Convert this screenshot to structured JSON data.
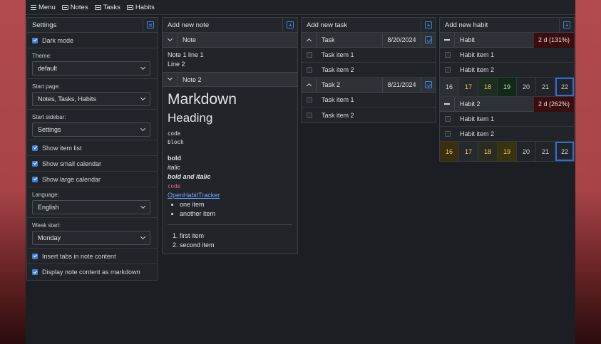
{
  "topbar": {
    "menu": "Menu",
    "notes": "Notes",
    "tasks": "Tasks",
    "habits": "Habits"
  },
  "settings": {
    "title": "Settings",
    "dark_mode": "Dark mode",
    "theme_label": "Theme:",
    "theme_value": "default",
    "start_page_label": "Start page:",
    "start_page_value": "Notes, Tasks, Habits",
    "start_sidebar_label": "Start sidebar:",
    "start_sidebar_value": "Settings",
    "show_item_list": "Show item list",
    "show_small_calendar": "Show small calendar",
    "show_large_calendar": "Show large calendar",
    "language_label": "Language:",
    "language_value": "English",
    "week_start_label": "Week start:",
    "week_start_value": "Monday",
    "insert_tabs": "Insert tabs in note content",
    "display_markdown": "Display note content as markdown"
  },
  "notes": {
    "title": "Add new note",
    "note1": {
      "name": "Note",
      "line1": "Note 1 line 1",
      "line2": "Line 2"
    },
    "note2": {
      "name": "Note 2",
      "h1": "Markdown",
      "h2": "Heading",
      "code1": "code",
      "code2": "block",
      "bold": "bold",
      "italic": "italic",
      "bold_italic": "bold and italic",
      "inline_code": "code",
      "link": "OpenHabitTracker",
      "ul1": "one item",
      "ul2": "another item",
      "ol1": "first item",
      "ol2": "second item"
    }
  },
  "tasks": {
    "title": "Add new task",
    "task1": {
      "name": "Task",
      "date": "8/20/2024",
      "item1": "Task item 1",
      "item2": "Task item 2"
    },
    "task2": {
      "name": "Task 2",
      "date": "8/21/2024",
      "item1": "Task item 1",
      "item2": "Task item 2"
    }
  },
  "habits": {
    "title": "Add new habit",
    "habit1": {
      "name": "Habit",
      "badge": "2 d (131%)",
      "item1": "Habit item 1",
      "item2": "Habit item 2",
      "days": [
        "16",
        "17",
        "18",
        "19",
        "20",
        "21",
        "22"
      ]
    },
    "habit2": {
      "name": "Habit 2",
      "badge": "2 d (262%)",
      "item1": "Habit item 1",
      "item2": "Habit item 2",
      "days": [
        "16",
        "17",
        "18",
        "19",
        "20",
        "21",
        "22"
      ]
    }
  },
  "colors": {
    "accent": "#3f7fd6",
    "badge_bg": "#3a0d10",
    "habit1_day_colors": [
      "#2c3034",
      "#262a2e",
      "#1e2d22",
      "#0f2a17",
      "#212428",
      "#212428",
      "#212428"
    ],
    "habit1_text_colors": [
      "#d4d6d9",
      "#f0c75e",
      "#f0c75e",
      "#d4d6d9",
      "#d4d6d9",
      "#d4d6d9",
      "#d4d6d9"
    ],
    "habit2_day_colors": [
      "#3a2e10",
      "#262a2e",
      "#2a2c22",
      "#3a3310",
      "#212428",
      "#212428",
      "#212428"
    ],
    "habit2_text_colors": [
      "#f0c75e",
      "#f0c75e",
      "#f0c75e",
      "#f0c75e",
      "#d4d6d9",
      "#d4d6d9",
      "#d4d6d9"
    ]
  }
}
